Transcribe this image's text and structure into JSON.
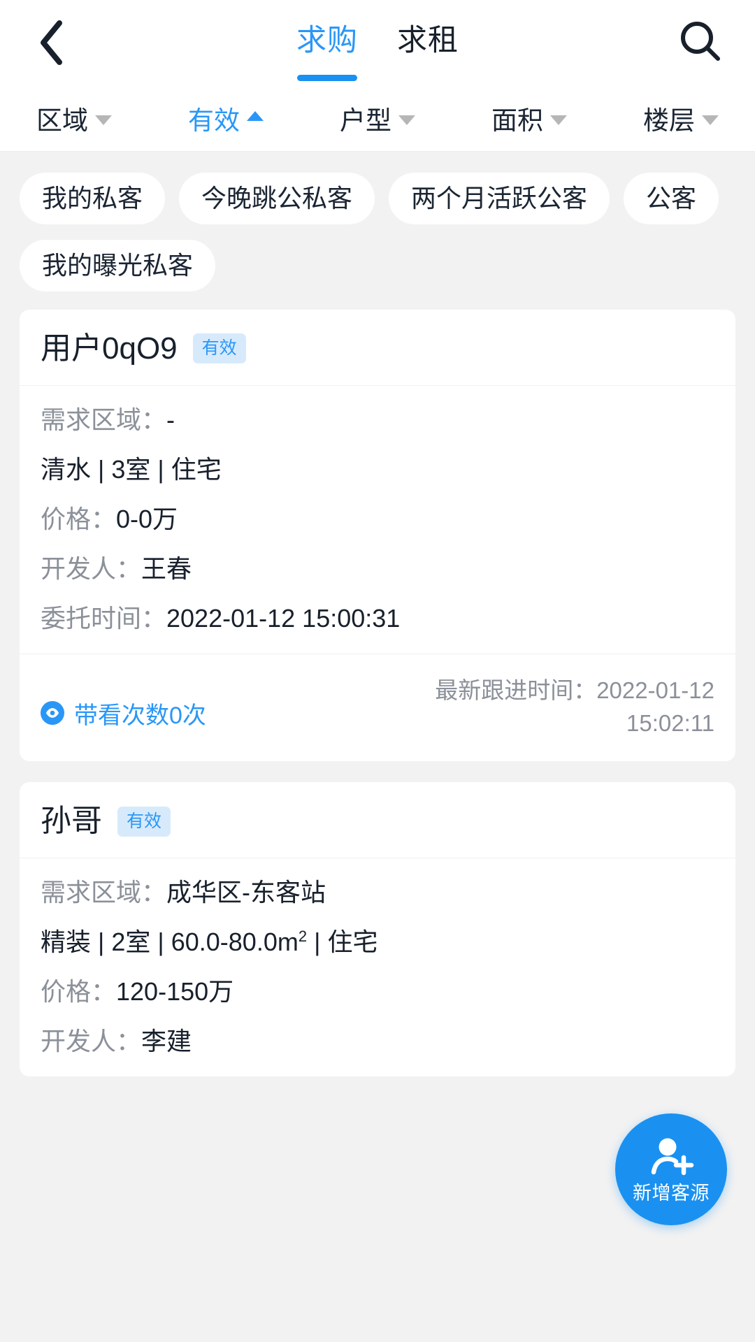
{
  "navbar": {
    "back_icon": "chevron-left-icon",
    "search_icon": "search-icon",
    "tabs": [
      {
        "label": "求购",
        "active": true
      },
      {
        "label": "求租",
        "active": false
      }
    ]
  },
  "filterbar": {
    "items": [
      {
        "label": "区域",
        "state": "collapsed",
        "active": false
      },
      {
        "label": "有效",
        "state": "expanded",
        "active": true
      },
      {
        "label": "户型",
        "state": "collapsed",
        "active": false
      },
      {
        "label": "面积",
        "state": "collapsed",
        "active": false
      },
      {
        "label": "楼层",
        "state": "collapsed",
        "active": false
      }
    ]
  },
  "chips": [
    {
      "label": "我的私客"
    },
    {
      "label": "今晚跳公私客"
    },
    {
      "label": "两个月活跃公客"
    },
    {
      "label": "公客"
    },
    {
      "label": "我的曝光私客"
    }
  ],
  "cards": [
    {
      "name": "用户0qO9",
      "badge": "有效",
      "area_label": "需求区域：",
      "area_value": "-",
      "spec": "清水 | 3室 | 住宅",
      "price_label": "价格：",
      "price_value": "0-0万",
      "developer_label": "开发人：",
      "developer_value": "王春",
      "entrust_label": "委托时间：",
      "entrust_value": "2022-01-12 15:00:31",
      "views_label": "带看次数0次",
      "views_icon": "eye-icon",
      "followup_label": "最新跟进时间：",
      "followup_value": "2022-01-12 15:02:11"
    },
    {
      "name": "孙哥",
      "badge": "有效",
      "area_label": "需求区域：",
      "area_value": "成华区-东客站",
      "spec_prefix": "精装 | 2室 | 60.0-80.0m",
      "spec_sup": "2",
      "spec_suffix": " | 住宅",
      "price_label": "价格：",
      "price_value": "120-150万",
      "developer_label": "开发人：",
      "developer_value": "李建"
    }
  ],
  "fab": {
    "label": "新增客源",
    "icon": "add-user-icon"
  },
  "colors": {
    "accent_blue": "#2a97f7",
    "tab_underline": "#1a91f0",
    "badge_bg": "#d7eafc",
    "page_bg": "#f2f2f2",
    "card_bg": "#ffffff",
    "text_primary": "#18202c",
    "text_muted": "#8b9099",
    "fab_bg": "#1a91f0"
  }
}
